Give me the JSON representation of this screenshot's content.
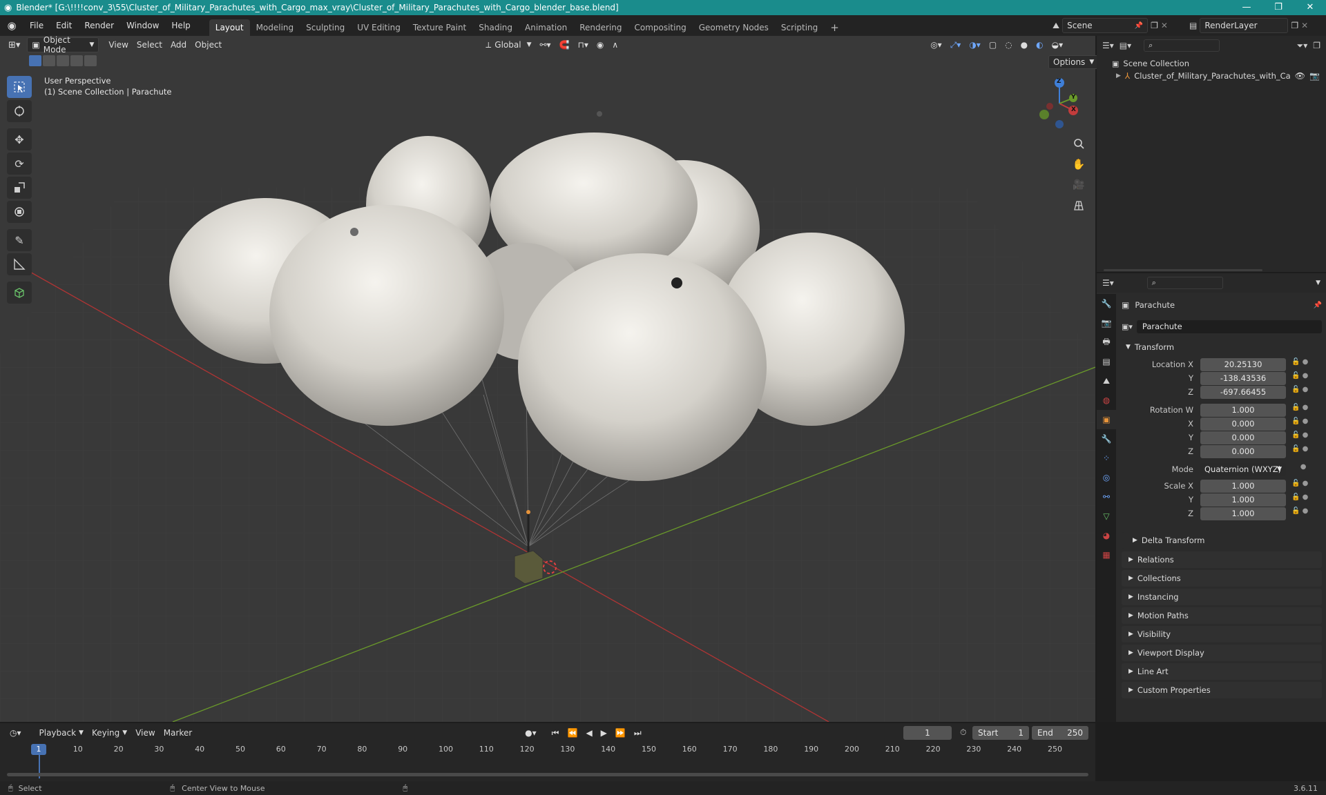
{
  "window": {
    "title": "Blender* [G:\\!!!!conv_3\\55\\Cluster_of_Military_Parachutes_with_Cargo_max_vray\\Cluster_of_Military_Parachutes_with_Cargo_blender_base.blend]"
  },
  "menus": [
    "File",
    "Edit",
    "Render",
    "Window",
    "Help"
  ],
  "workspaces": [
    "Layout",
    "Modeling",
    "Sculpting",
    "UV Editing",
    "Texture Paint",
    "Shading",
    "Animation",
    "Rendering",
    "Compositing",
    "Geometry Nodes",
    "Scripting"
  ],
  "active_workspace": "Layout",
  "scene": {
    "name": "Scene",
    "render_layer": "RenderLayer"
  },
  "viewport": {
    "mode": "Object Mode",
    "menus": [
      "View",
      "Select",
      "Add",
      "Object"
    ],
    "orientation": "Global",
    "options_label": "Options",
    "info_line1": "User Perspective",
    "info_line2": "(1) Scene Collection | Parachute",
    "gizmo": {
      "x": "X",
      "y": "Y",
      "z": "Z"
    }
  },
  "outliner": {
    "root": "Scene Collection",
    "items": [
      {
        "name": "Cluster_of_Military_Parachutes_with_Ca"
      }
    ]
  },
  "properties": {
    "object_name": "Parachute",
    "data_name": "Parachute",
    "transform_title": "Transform",
    "location_label": "Location X",
    "location": {
      "x": "20.25130",
      "y": "-138.43536",
      "z": "-697.66455"
    },
    "rotation_label": "Rotation W",
    "rotation": {
      "w": "1.000",
      "x": "0.000",
      "y": "0.000",
      "z": "0.000"
    },
    "mode_label": "Mode",
    "mode_value": "Quaternion (WXYZ)",
    "scale_label": "Scale X",
    "scale": {
      "x": "1.000",
      "y": "1.000",
      "z": "1.000"
    },
    "axis_y": "Y",
    "axis_z": "Z",
    "axis_x": "X",
    "delta_transform": "Delta Transform",
    "panels": [
      "Relations",
      "Collections",
      "Instancing",
      "Motion Paths",
      "Visibility",
      "Viewport Display",
      "Line Art",
      "Custom Properties"
    ]
  },
  "timeline": {
    "menus": [
      "Playback",
      "Keying",
      "View",
      "Marker"
    ],
    "current_frame": "1",
    "start_label": "Start",
    "start": "1",
    "end_label": "End",
    "end": "250",
    "ruler": [
      "10",
      "20",
      "30",
      "40",
      "50",
      "60",
      "70",
      "80",
      "90",
      "100",
      "110",
      "120",
      "130",
      "140",
      "150",
      "160",
      "170",
      "180",
      "190",
      "200",
      "210",
      "220",
      "230",
      "240",
      "250"
    ],
    "ruler_current": "1"
  },
  "status": {
    "select": "Select",
    "center_view": "Center View to Mouse",
    "version": "3.6.11"
  },
  "colors": {
    "accent": "#4772b3",
    "titlebar": "#1a8c8c",
    "x_axis": "#c23c3c",
    "y_axis": "#6a9a2a",
    "z_axis": "#3f7fd8",
    "object_orange": "#e8943a"
  }
}
